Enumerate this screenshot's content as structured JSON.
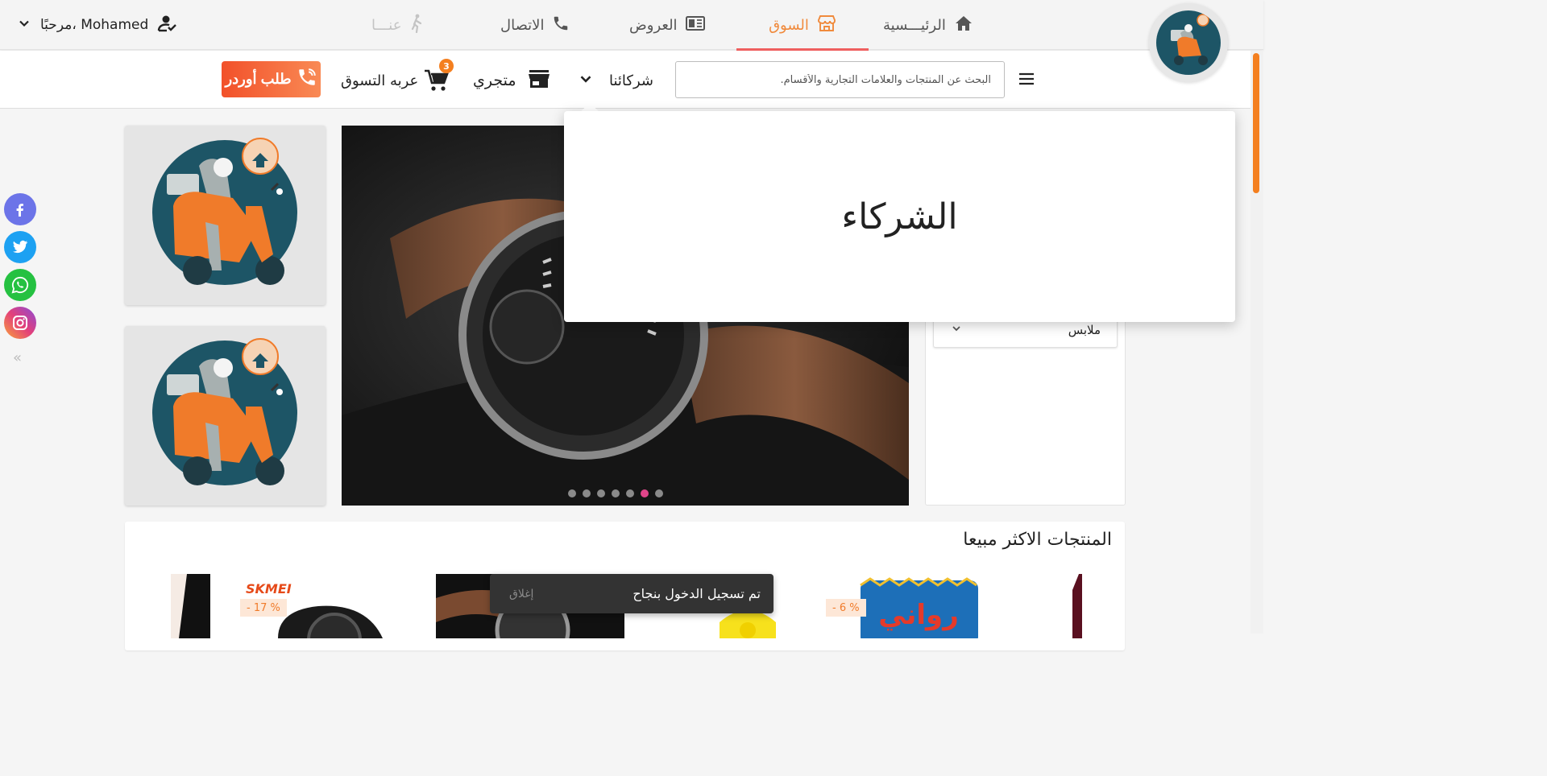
{
  "nav": {
    "home": "الرئيـــسية",
    "market": "السوق",
    "offers": "العروض",
    "contact": "الاتصال",
    "about": "عنـــا",
    "user_greeting": "مرحبًا، Mohamed"
  },
  "search": {
    "placeholder": "البحث عن المنتجات والعلامات التجارية والأقسام."
  },
  "toolbar": {
    "partners": "شركائنا",
    "my_store": "متجري",
    "cart": "عربه التسوق",
    "cart_count": "3",
    "order_button": "طلب أوردر"
  },
  "popup": {
    "title": "الشركاء"
  },
  "categories": {
    "visible_item": "ملابس"
  },
  "slider": {
    "dot_count": 7,
    "active_dot": 6
  },
  "best_sellers": {
    "title": "المنتجات الاكثر مبيعا",
    "discounts": [
      "- 17 %",
      "- 6 %"
    ],
    "brand_text": "SKMEI",
    "product_text": "رواني"
  },
  "snackbar": {
    "message": "تم تسجيل الدخول بنجاح",
    "close": "إغلاق"
  },
  "social": [
    "facebook",
    "twitter",
    "whatsapp",
    "instagram"
  ],
  "colors": {
    "accent": "#f08a3c",
    "active_underline": "#ef5f5f",
    "order_button": "#f2512a",
    "badge": "#f47f1f",
    "facebook": "#6c74e8",
    "twitter": "#1da1f2",
    "whatsapp": "#25c141",
    "instagram": "#d93b8c"
  }
}
